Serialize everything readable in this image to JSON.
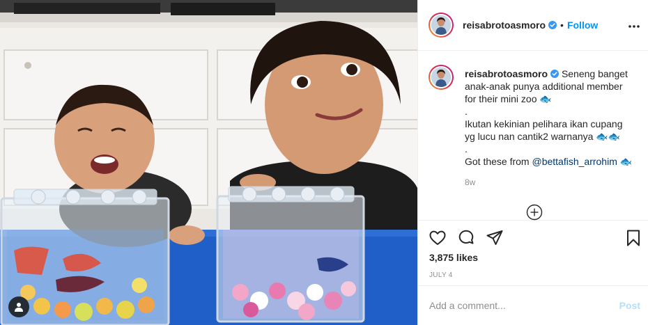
{
  "post": {
    "username": "reisabrotoasmoro",
    "verified": true,
    "separator": "•",
    "follow_label": "Follow",
    "more_icon": "more-horizontal-icon"
  },
  "caption": {
    "username": "reisabrotoasmoro",
    "line1_text": "Seneng banget",
    "line2": "anak-anak punya additional member",
    "line3": "for their mini zoo 🐟",
    "line4": ".",
    "line5": "Ikutan kekinian pelihara ikan cupang",
    "line6": "yg lucu nan cantik2 warnanya 🐟🐟",
    "line7": ".",
    "line8_text": "Got these from ",
    "line8_mention": "@bettafish_arrohim",
    "line8_tail": " 🐟",
    "time_ago": "8w"
  },
  "actions": {
    "like_icon": "heart-icon",
    "comment_icon": "comment-icon",
    "share_icon": "share-icon",
    "save_icon": "bookmark-icon",
    "likes": "3,875 likes",
    "date": "JULY 4"
  },
  "comment": {
    "placeholder": "Add a comment...",
    "post_label": "Post"
  },
  "colors": {
    "follow_blue": "#0095f6",
    "verified_blue": "#3897f0",
    "post_button_disabled": "#b2dffc",
    "border": "#efefef",
    "muted": "#8e8e8e",
    "table_blue": "#1f5fc7"
  }
}
